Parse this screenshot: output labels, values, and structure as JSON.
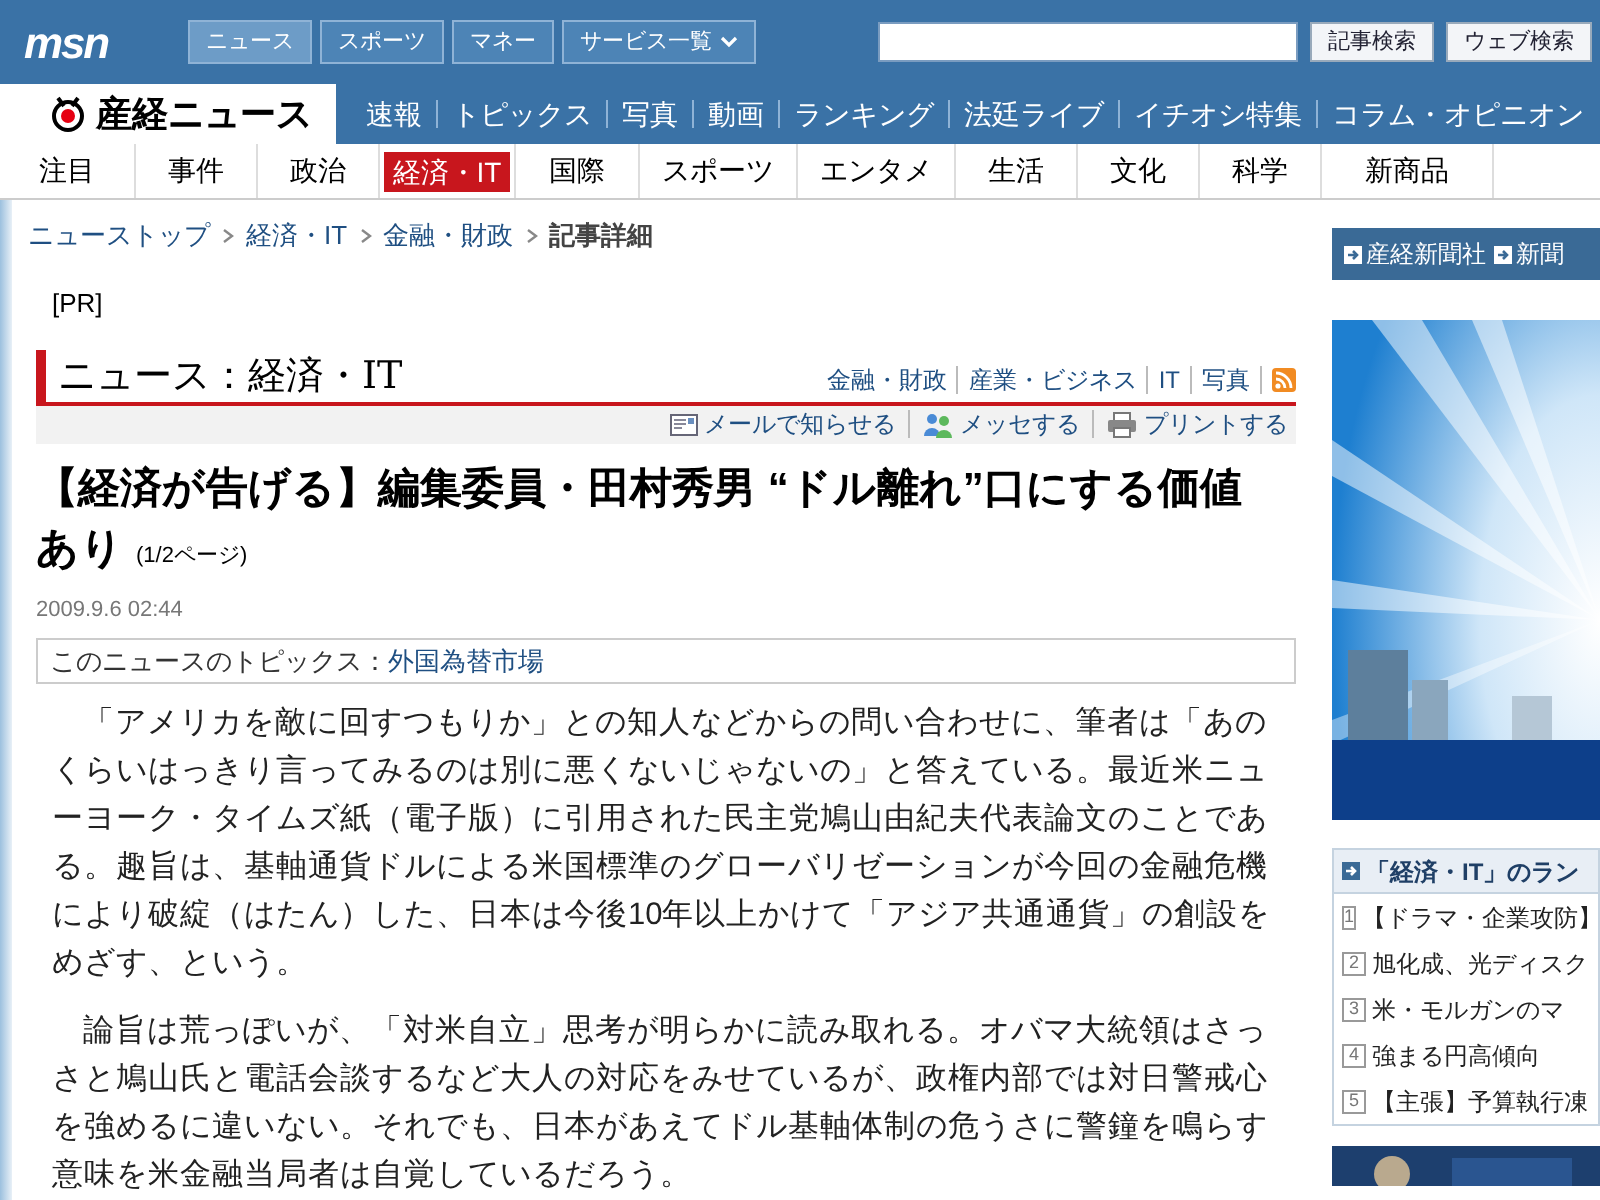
{
  "top_bar": {
    "logo": "msn",
    "tabs": [
      {
        "label": "ニュース",
        "selected": true
      },
      {
        "label": "スポーツ",
        "selected": false
      },
      {
        "label": "マネー",
        "selected": false
      },
      {
        "label": "サービス一覧",
        "selected": false
      }
    ],
    "search_buttons": [
      "記事検索",
      "ウェブ検索"
    ]
  },
  "site_logo": "産経ニュース",
  "main_nav": [
    "速報",
    "トピックス",
    "写真",
    "動画",
    "ランキング",
    "法廷ライブ",
    "イチオシ特集",
    "コラム・オピニオン"
  ],
  "category_tabs": [
    {
      "label": "注目",
      "selected": false
    },
    {
      "label": "事件",
      "selected": false
    },
    {
      "label": "政治",
      "selected": false
    },
    {
      "label": "経済・IT",
      "selected": true
    },
    {
      "label": "国際",
      "selected": false
    },
    {
      "label": "スポーツ",
      "selected": false
    },
    {
      "label": "エンタメ",
      "selected": false
    },
    {
      "label": "生活",
      "selected": false
    },
    {
      "label": "文化",
      "selected": false
    },
    {
      "label": "科学",
      "selected": false
    },
    {
      "label": "新商品",
      "selected": false
    }
  ],
  "breadcrumb": {
    "links": [
      "ニューストップ",
      "経済・IT",
      "金融・財政"
    ],
    "current": "記事詳細"
  },
  "pr": "[PR]",
  "section": {
    "title": "ニュース：経済・IT",
    "links": [
      "金融・財政",
      "産業・ビジネス",
      "IT",
      "写真"
    ]
  },
  "tools": [
    "メールで知らせる",
    "メッセする",
    "プリントする"
  ],
  "article": {
    "headline": "【経済が告げる】編集委員・田村秀男 “ドル離れ”口にする価値あり",
    "page": "(1/2ページ)",
    "date": "2009.9.6 02:44",
    "topics_label": "このニュースのトピックス：",
    "topic": "外国為替市場",
    "paragraphs": [
      "「アメリカを敵に回すつもりか」との知人などからの問い合わせに、筆者は「あのくらいはっきり言ってみるのは別に悪くないじゃないの」と答えている。最近米ニューヨーク・タイムズ紙（電子版）に引用された民主党鳩山由紀夫代表論文のことである。趣旨は、基軸通貨ドルによる米国標準のグローバリゼーションが今回の金融危機により破綻（はたん）した、日本は今後10年以上かけて「アジア共通通貨」の創設をめざす、という。",
      "論旨は荒っぽいが、「対米自立」思考が明らかに読み取れる。オバマ大統領はさっさと鳩山氏と電話会談するなど大人の対応をみせているが、政権内部では対日警戒心を強めるに違いない。それでも、日本があえてドル基軸体制の危うさに警鐘を鳴らす意味を米金融当局者は自覚しているだろう。"
    ]
  },
  "sidebar": {
    "links": [
      "産経新聞社",
      "新聞"
    ],
    "ranking": {
      "title": "「経済・IT」のラン",
      "items": [
        {
          "rank": "1",
          "title": "【ドラマ・企業攻防】"
        },
        {
          "rank": "2",
          "title": "旭化成、光ディスク"
        },
        {
          "rank": "3",
          "title": "米・モルガンのマ"
        },
        {
          "rank": "4",
          "title": "強まる円高傾向"
        },
        {
          "rank": "5",
          "title": "【主張】予算執行凍"
        }
      ]
    }
  }
}
